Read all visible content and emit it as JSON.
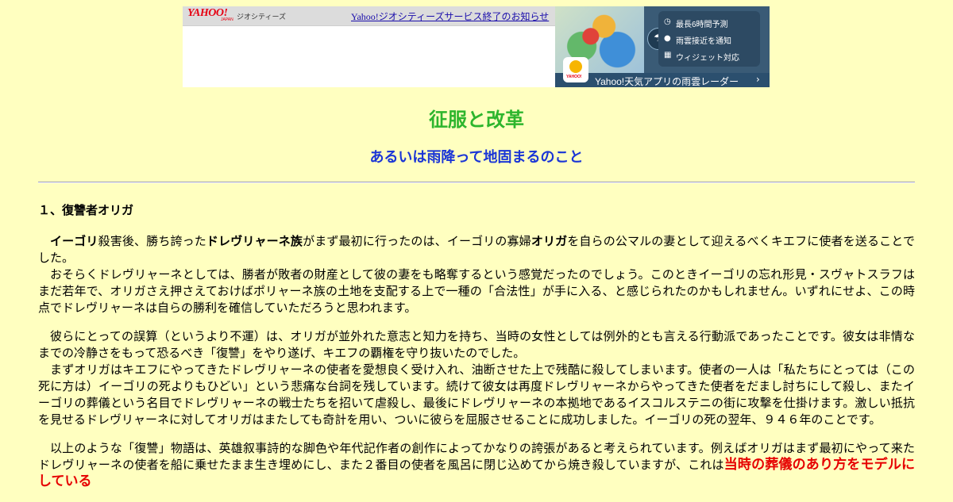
{
  "banner": {
    "logo_text": "YAHOO!",
    "logo_sub": "JAPAN",
    "service_label": "ジオシティーズ",
    "notice_link": "Yahoo!ジオシティーズサービス終了のお知らせ",
    "ad": {
      "features": [
        "最長6時間予測",
        "雨雲接近を通知",
        "ウィジェット対応"
      ],
      "app_logo": "YAHOO!",
      "caption": "Yahoo!天気アプリの雨雲レーダー",
      "chevron": "›"
    }
  },
  "page": {
    "title": "征服と改革",
    "subtitle": "あるいは雨降って地固まるのこと"
  },
  "section": {
    "heading": "１、復讐者オリガ",
    "p1": {
      "s1_name1": "イーゴリ",
      "s1_t1": "殺害後、勝ち誇った",
      "s1_name2": "ドレヴリャーネ族",
      "s1_t2": "がまず最初に行ったのは、イーゴリの寡婦",
      "s1_name3": "オリガ",
      "s1_t3": "を自らの公マルの妻として迎えるべくキエフに使者を送ることでした。",
      "s2": "おそらくドレヴリャーネとしては、勝者が敗者の財産として彼の妻をも略奪するという感覚だったのでしょう。このときイーゴリの忘れ形見・スヴャトスラフはまだ若年で、オリガさえ押さえておけばポリャーネ族の土地を支配する上で一種の「合法性」が手に入る、と感じられたのかもしれません。いずれにせよ、この時点でドレヴリャーネは自らの勝利を確信していただろうと思われます。"
    },
    "p2": {
      "s1": "彼らにとっての誤算（というより不運）は、オリガが並外れた意志と知力を持ち、当時の女性としては例外的とも言える行動派であったことです。彼女は非情なまでの冷静さをもって恐るべき「復讐」をやり遂げ、キエフの覇権を守り抜いたのでした。",
      "s2": "まずオリガはキエフにやってきたドレヴリャーネの使者を愛想良く受け入れ、油断させた上で残酷に殺してしまいます。使者の一人は「私たちにとっては（この死に方は）イーゴリの死よりもひどい」という悲痛な台詞を残しています。続けて彼女は再度ドレヴリャーネからやってきた使者をだまし討ちにして殺し、またイーゴリの葬儀という名目でドレヴリャーネの戦士たちを招いて虐殺し、最後にドレヴリャーネの本拠地であるイスコルステニの街に攻撃を仕掛けます。激しい抵抗を見せるドレヴリャーネに対してオリガはまたしても奇計を用い、ついに彼らを屈服させることに成功しました。イーゴリの死の翌年、９４６年のことです。"
    },
    "p3": {
      "t1": "以上のような「復讐」物語は、英雄叙事詩的な脚色や年代記作者の創作によってかなりの誇張があると考えられています。例えばオリガはまず最初にやって来たドレヴリャーネの使者を船に乗せたまま生き埋めにし、また２番目の使者を風呂に閉じ込めてから焼き殺していますが、これは",
      "red": "当時の葬儀のあり方をモデルにしている"
    }
  }
}
